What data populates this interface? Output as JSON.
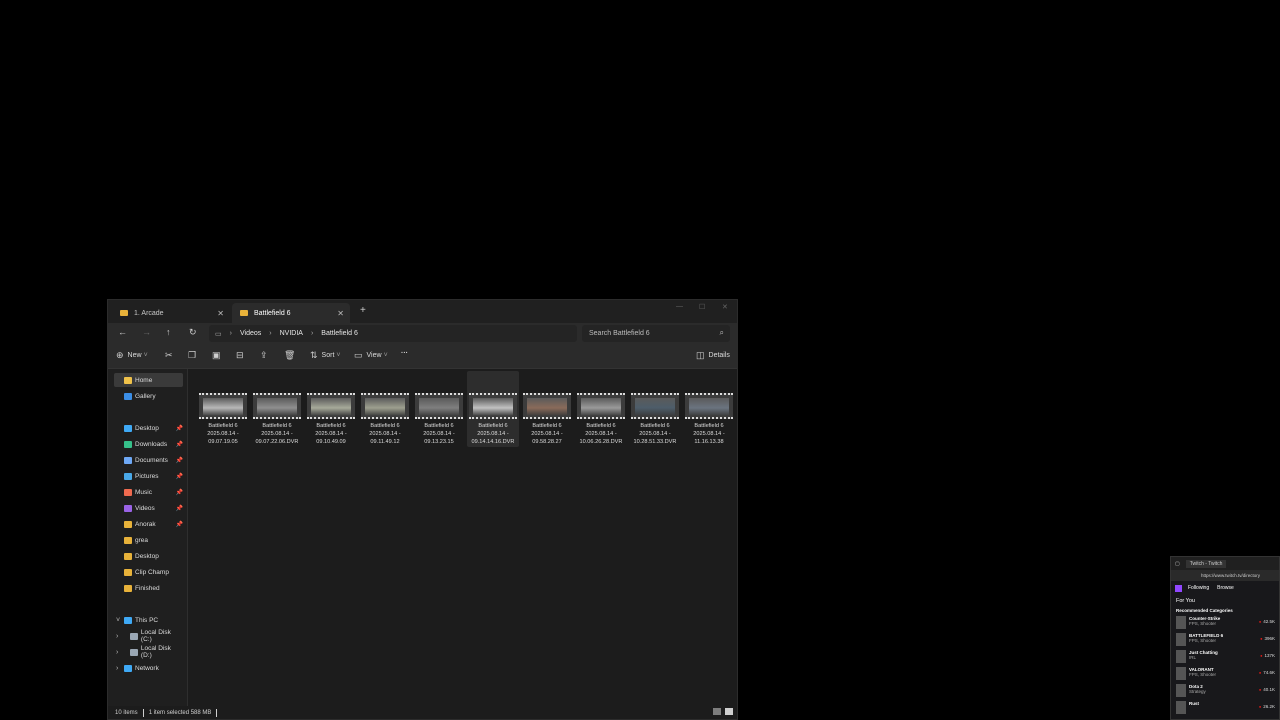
{
  "tabs": [
    {
      "label": "1. Arcade",
      "active": false
    },
    {
      "label": "Battlefield 6",
      "active": true
    }
  ],
  "address": {
    "crumbs": [
      "Videos",
      "NVIDIA",
      "Battlefield 6"
    ],
    "search_placeholder": "Search Battlefield 6"
  },
  "toolbar": {
    "new_label": "New",
    "sort_label": "Sort",
    "view_label": "View",
    "more_label": "···",
    "details_label": "Details"
  },
  "sidebar": {
    "top": [
      {
        "label": "Home",
        "selected": true,
        "color": "#f0c24a"
      },
      {
        "label": "Gallery",
        "selected": false,
        "color": "#3b8ee6"
      }
    ],
    "quick": [
      {
        "label": "Desktop",
        "color": "#3fa9f5",
        "pinned": true
      },
      {
        "label": "Downloads",
        "color": "#36c08a",
        "pinned": true
      },
      {
        "label": "Documents",
        "color": "#6ea8f5",
        "pinned": true
      },
      {
        "label": "Pictures",
        "color": "#49a8e8",
        "pinned": true
      },
      {
        "label": "Music",
        "color": "#ef6a4f",
        "pinned": true
      },
      {
        "label": "Videos",
        "color": "#9a63e6",
        "pinned": true
      },
      {
        "label": "Anorak",
        "color": "#e8b23a",
        "pinned": true
      },
      {
        "label": "grea",
        "color": "#e8b23a",
        "pinned": false
      },
      {
        "label": "Desktop",
        "color": "#e8b23a",
        "pinned": false
      },
      {
        "label": "Clip Champ",
        "color": "#e8b23a",
        "pinned": false
      },
      {
        "label": "Finished",
        "color": "#e8b23a",
        "pinned": false
      }
    ],
    "tree": [
      {
        "label": "This PC",
        "expanded": true,
        "color": "#3fa9f5"
      },
      {
        "label": "Local Disk (C:)",
        "expanded": false,
        "color": "#9aa7b4"
      },
      {
        "label": "Local Disk (D:)",
        "expanded": false,
        "color": "#9aa7b4"
      },
      {
        "label": "Network",
        "expanded": false,
        "color": "#3fa9f5"
      }
    ]
  },
  "files": [
    {
      "l1": "Battlefield 6",
      "l2": "2025.08.14 -",
      "l3": "09.07.19.05",
      "tone": "#b8b8b8",
      "selected": false
    },
    {
      "l1": "Battlefield 6",
      "l2": "2025.08.14 -",
      "l3": "09.07.22.06.DVR",
      "tone": "#8f8f8f",
      "selected": false
    },
    {
      "l1": "Battlefield 6",
      "l2": "2025.08.14 -",
      "l3": "09.10.49.09",
      "tone": "#a7aa9a",
      "selected": false
    },
    {
      "l1": "Battlefield 6",
      "l2": "2025.08.14 -",
      "l3": "09.11.49.12",
      "tone": "#9ea08f",
      "selected": false
    },
    {
      "l1": "Battlefield 6",
      "l2": "2025.08.14 -",
      "l3": "09.13.23.15",
      "tone": "#7f7f7f",
      "selected": false
    },
    {
      "l1": "Battlefield 6",
      "l2": "2025.08.14 -",
      "l3": "09.14.14.16.DVR",
      "tone": "#c2c2c2",
      "selected": true
    },
    {
      "l1": "Battlefield 6",
      "l2": "2025.08.14 -",
      "l3": "09.58.28.27",
      "tone": "#8a6b5a",
      "selected": false
    },
    {
      "l1": "Battlefield 6",
      "l2": "2025.08.14 -",
      "l3": "10.06.26.28.DVR",
      "tone": "#9a9a9a",
      "selected": false
    },
    {
      "l1": "Battlefield 6",
      "l2": "2025.08.14 -",
      "l3": "10.28.51.33.DVR",
      "tone": "#4d5d6a",
      "selected": false
    },
    {
      "l1": "Battlefield 6",
      "l2": "2025.08.14 -",
      "l3": "11.16.13.38",
      "tone": "#6b7480",
      "selected": false
    }
  ],
  "status": {
    "count": "10 items",
    "selection": "1 item selected  588 MB"
  },
  "twitch": {
    "tab_title": "Twitch - Twitch",
    "url": "https://www.twitch.tv/directory",
    "nav_following": "Following",
    "nav_browse": "Browse",
    "for_you": "For You",
    "recommended": "Recommended Categories",
    "rows": [
      {
        "name": "Counter-Strike",
        "tags": "FPS, Shooter",
        "viewers": "42.5K"
      },
      {
        "name": "BATTLEFIELD 6",
        "tags": "FPS, Shooter",
        "viewers": "396K"
      },
      {
        "name": "Just Chatting",
        "tags": "IRL",
        "viewers": "137K"
      },
      {
        "name": "VALORANT",
        "tags": "FPS, Shooter",
        "viewers": "74.6K"
      },
      {
        "name": "Dota 2",
        "tags": "Strategy",
        "viewers": "40.1K"
      },
      {
        "name": "Rust",
        "tags": "",
        "viewers": "26.2K"
      }
    ]
  }
}
